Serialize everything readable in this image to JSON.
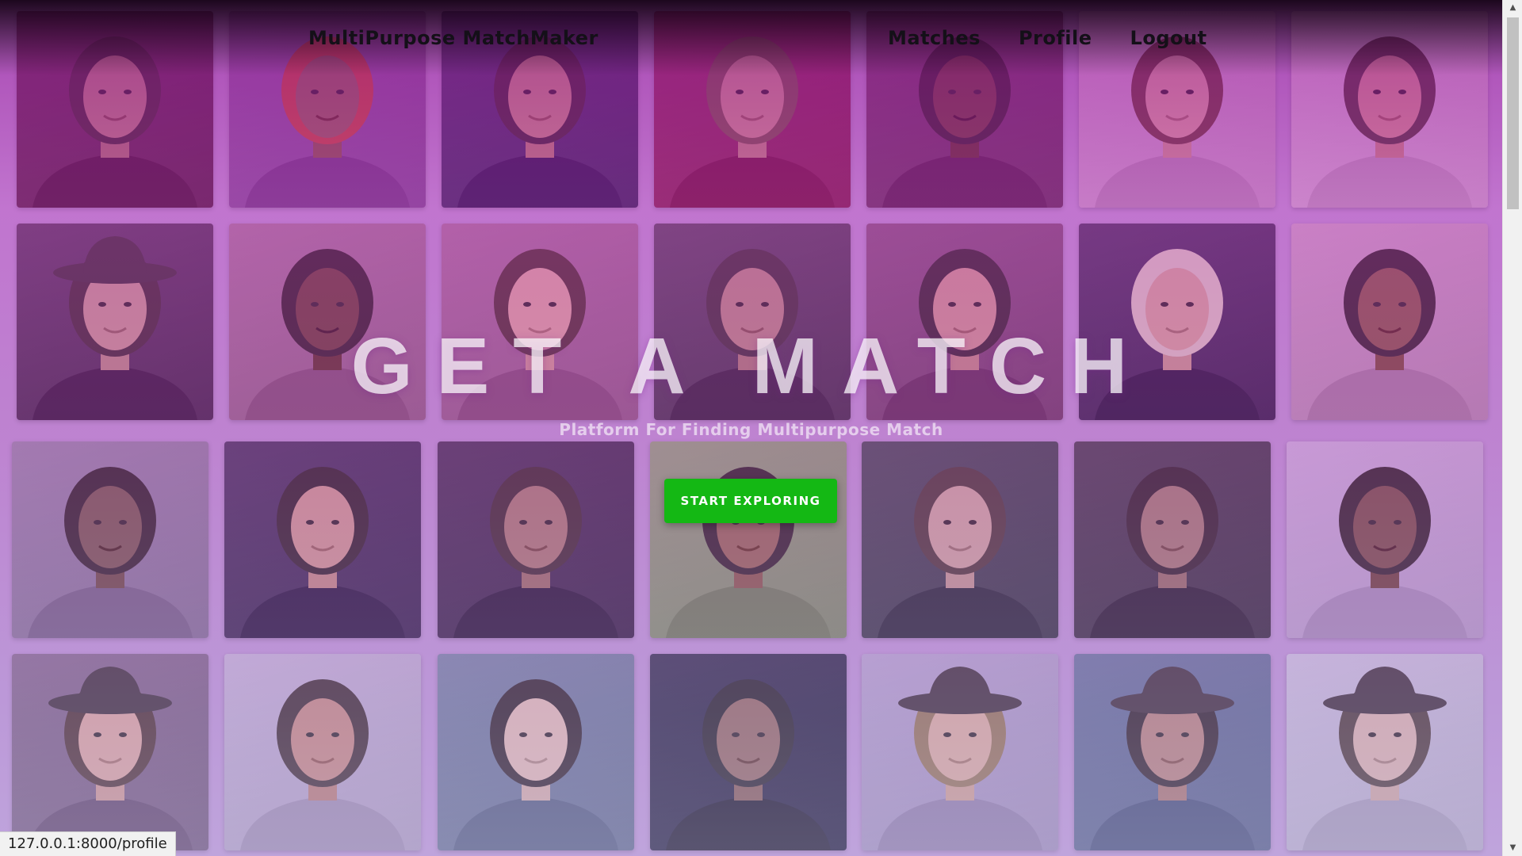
{
  "nav": {
    "brand": "MultiPurpose MatchMaker",
    "links": [
      {
        "id": "matches",
        "label": "Matches"
      },
      {
        "id": "profile",
        "label": "Profile"
      },
      {
        "id": "logout",
        "label": "Logout"
      }
    ]
  },
  "hero": {
    "title": "GET A MATCH",
    "subtitle": "Platform For Finding Multipurpose Match",
    "cta_label": "START EXPLORING"
  },
  "status_bar": {
    "url": "127.0.0.1:8000/profile"
  },
  "colors": {
    "accent_button": "#14b814",
    "overlay_top": "#140014",
    "overlay_mid": "#cd50cd",
    "overlay_bottom": "#c8bee6"
  },
  "grid": {
    "rows": 4,
    "columns": 7,
    "tiles": [
      {
        "bg": "#5a2a48",
        "skin": "#b07a6a",
        "hair": "#2a1a18",
        "hat": false
      },
      {
        "bg": "#8a5aa0",
        "skin": "#8a5a40",
        "hair": "#c04020",
        "hat": false
      },
      {
        "bg": "#3a3060",
        "skin": "#c08a70",
        "hair": "#241818",
        "hat": false
      },
      {
        "bg": "#8a2a50",
        "skin": "#c8907a",
        "hair": "#6a4a30",
        "hat": false
      },
      {
        "bg": "#6a3a60",
        "skin": "#5a3020",
        "hair": "#1a1010",
        "hat": false
      },
      {
        "bg": "#d8b0d8",
        "skin": "#d8a090",
        "hair": "#5a3020",
        "hat": false
      },
      {
        "bg": "#e0c0e0",
        "skin": "#d09080",
        "hair": "#3a2a20",
        "hat": false
      },
      {
        "bg": "#4a3050",
        "skin": "#c09080",
        "hair": "#2a1a1a",
        "hat": true
      },
      {
        "bg": "#a07090",
        "skin": "#5a3020",
        "hair": "#1a0e0e",
        "hat": false
      },
      {
        "bg": "#a06a90",
        "skin": "#d8a090",
        "hair": "#3a2018",
        "hat": false
      },
      {
        "bg": "#4a3a50",
        "skin": "#b08070",
        "hair": "#2a2020",
        "hat": false
      },
      {
        "bg": "#7a4a70",
        "skin": "#c89080",
        "hair": "#1e1414",
        "hat": false
      },
      {
        "bg": "#3a2850",
        "skin": "#d0a08a",
        "hair": "#d8c8b8",
        "hat": false
      },
      {
        "bg": "#c8a0c0",
        "skin": "#7a4a30",
        "hair": "#1a1010",
        "hat": false
      },
      {
        "bg": "#9080a0",
        "skin": "#6a4a3a",
        "hair": "#1a1010",
        "hat": false
      },
      {
        "bg": "#3a2a50",
        "skin": "#c89080",
        "hair": "#1a1010",
        "hat": false
      },
      {
        "bg": "#3a2848",
        "skin": "#a07060",
        "hair": "#2a1a18",
        "hat": false
      },
      {
        "bg": "#8aa070",
        "skin": "#8a5a40",
        "hair": "#1a1010",
        "hat": false
      },
      {
        "bg": "#3a4048",
        "skin": "#c8a090",
        "hair": "#3a2a20",
        "hat": false
      },
      {
        "bg": "#3a3440",
        "skin": "#9a7060",
        "hair": "#1a1010",
        "hat": false
      },
      {
        "bg": "#c8b0d8",
        "skin": "#6a4030",
        "hair": "#1a1010",
        "hat": false
      },
      {
        "bg": "#7a6080",
        "skin": "#d8a090",
        "hair": "#3a2018",
        "hat": true
      },
      {
        "bg": "#c0b0d0",
        "skin": "#c08070",
        "hair": "#2a1a18",
        "hat": false
      },
      {
        "bg": "#6a7a98",
        "skin": "#e0b8a8",
        "hair": "#1a1010",
        "hat": false
      },
      {
        "bg": "#20203a",
        "skin": "#8a6050",
        "hair": "#101010",
        "hat": false
      },
      {
        "bg": "#b0a0c8",
        "skin": "#d8a890",
        "hair": "#8a6a40",
        "hat": true
      },
      {
        "bg": "#5a6a90",
        "skin": "#b07a6a",
        "hair": "#1a1010",
        "hat": true
      },
      {
        "bg": "#c8c0d8",
        "skin": "#d8b0a0",
        "hair": "#3a2a20",
        "hat": true
      }
    ]
  }
}
